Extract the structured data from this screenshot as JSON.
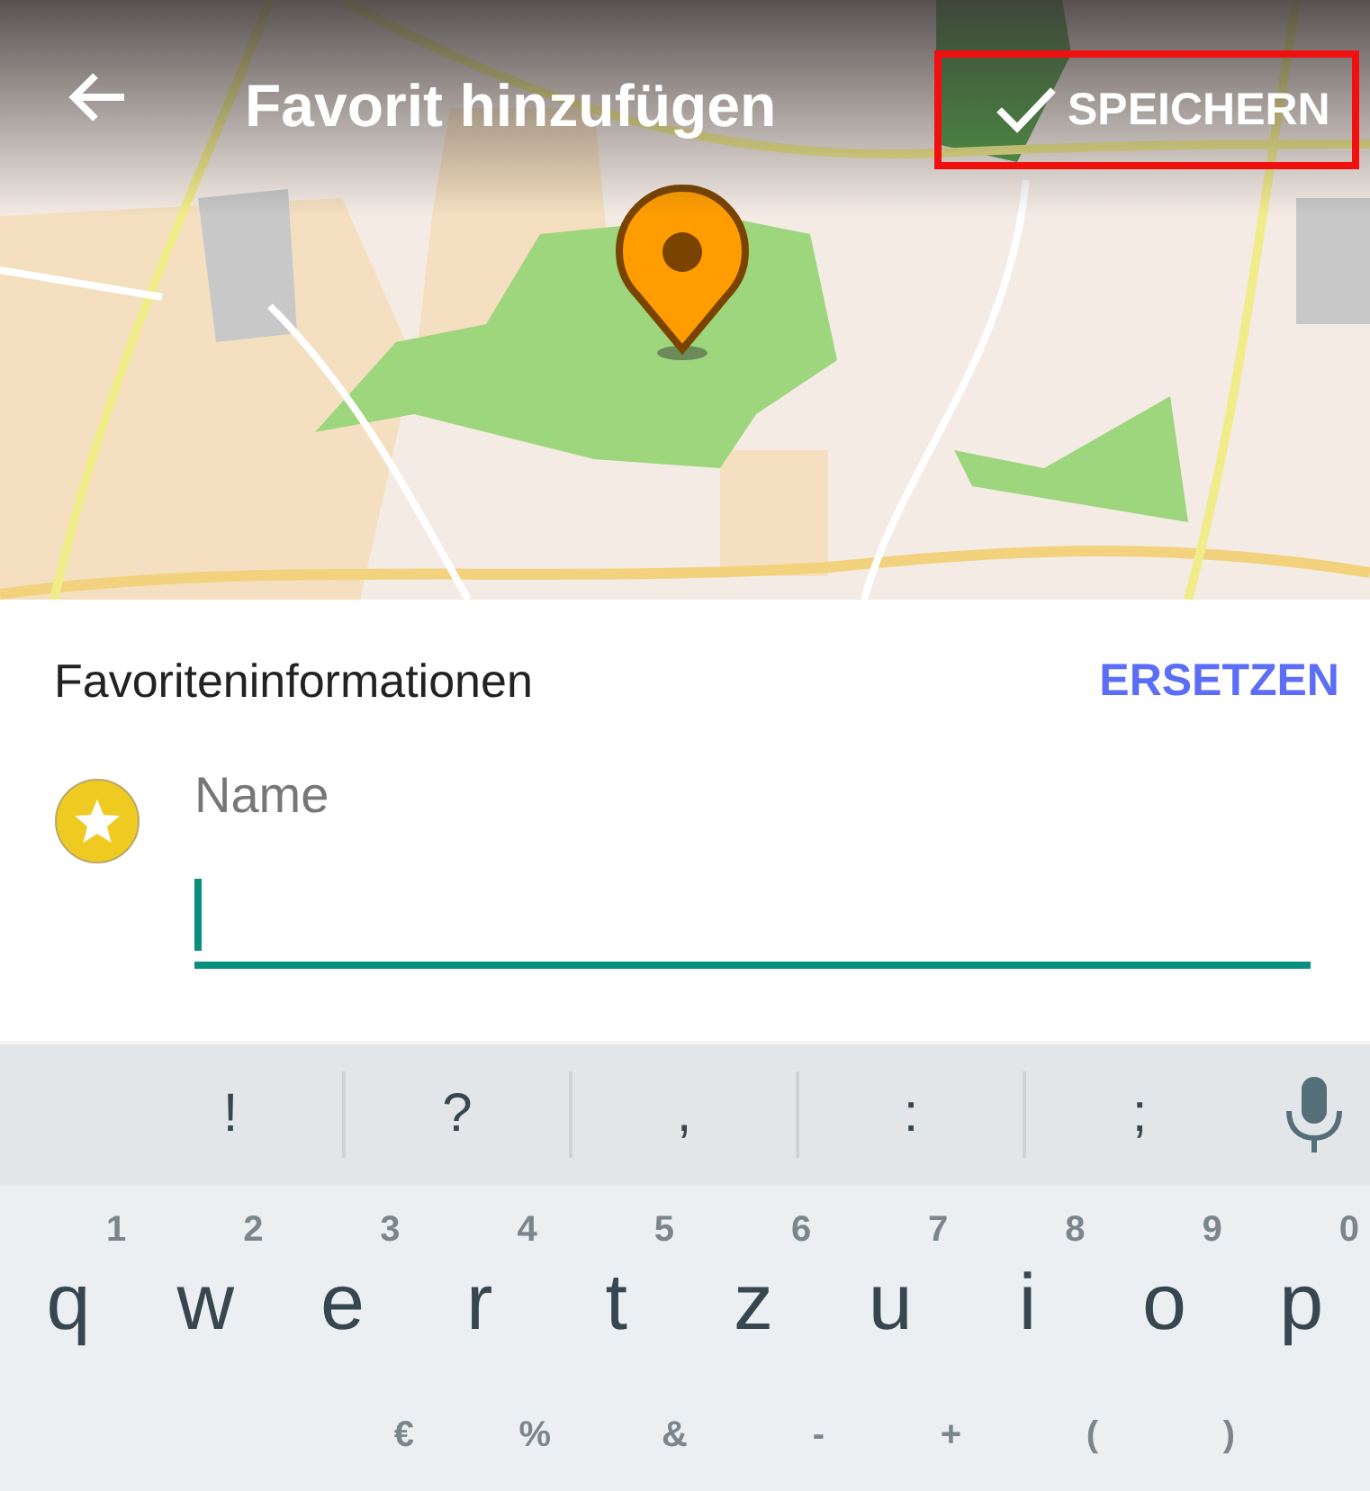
{
  "toolbar": {
    "title": "Favorit hinzufügen",
    "save": {
      "label": "SPEICHERN",
      "highlighted": true
    }
  },
  "form": {
    "section_title": "Favoriteninformationen",
    "action": "ERSETZEN",
    "field": {
      "placeholder": "Name",
      "focused": true
    }
  },
  "keyboard": {
    "suggestions": [
      "!",
      "?",
      ",",
      ":",
      ";"
    ],
    "letter_row": [
      {
        "label": "q",
        "hint": "1"
      },
      {
        "label": "w",
        "hint": "2"
      },
      {
        "label": "e",
        "hint": "3"
      },
      {
        "label": "r",
        "hint": "4"
      },
      {
        "label": "t",
        "hint": "5"
      },
      {
        "label": "z",
        "hint": "6"
      },
      {
        "label": "u",
        "hint": "7"
      },
      {
        "label": "i",
        "hint": "8"
      },
      {
        "label": "o",
        "hint": "9"
      },
      {
        "label": "p",
        "hint": "0"
      }
    ],
    "partial_row_hints": [
      "€",
      "%",
      "&",
      "-",
      "+",
      "(",
      ")"
    ]
  }
}
